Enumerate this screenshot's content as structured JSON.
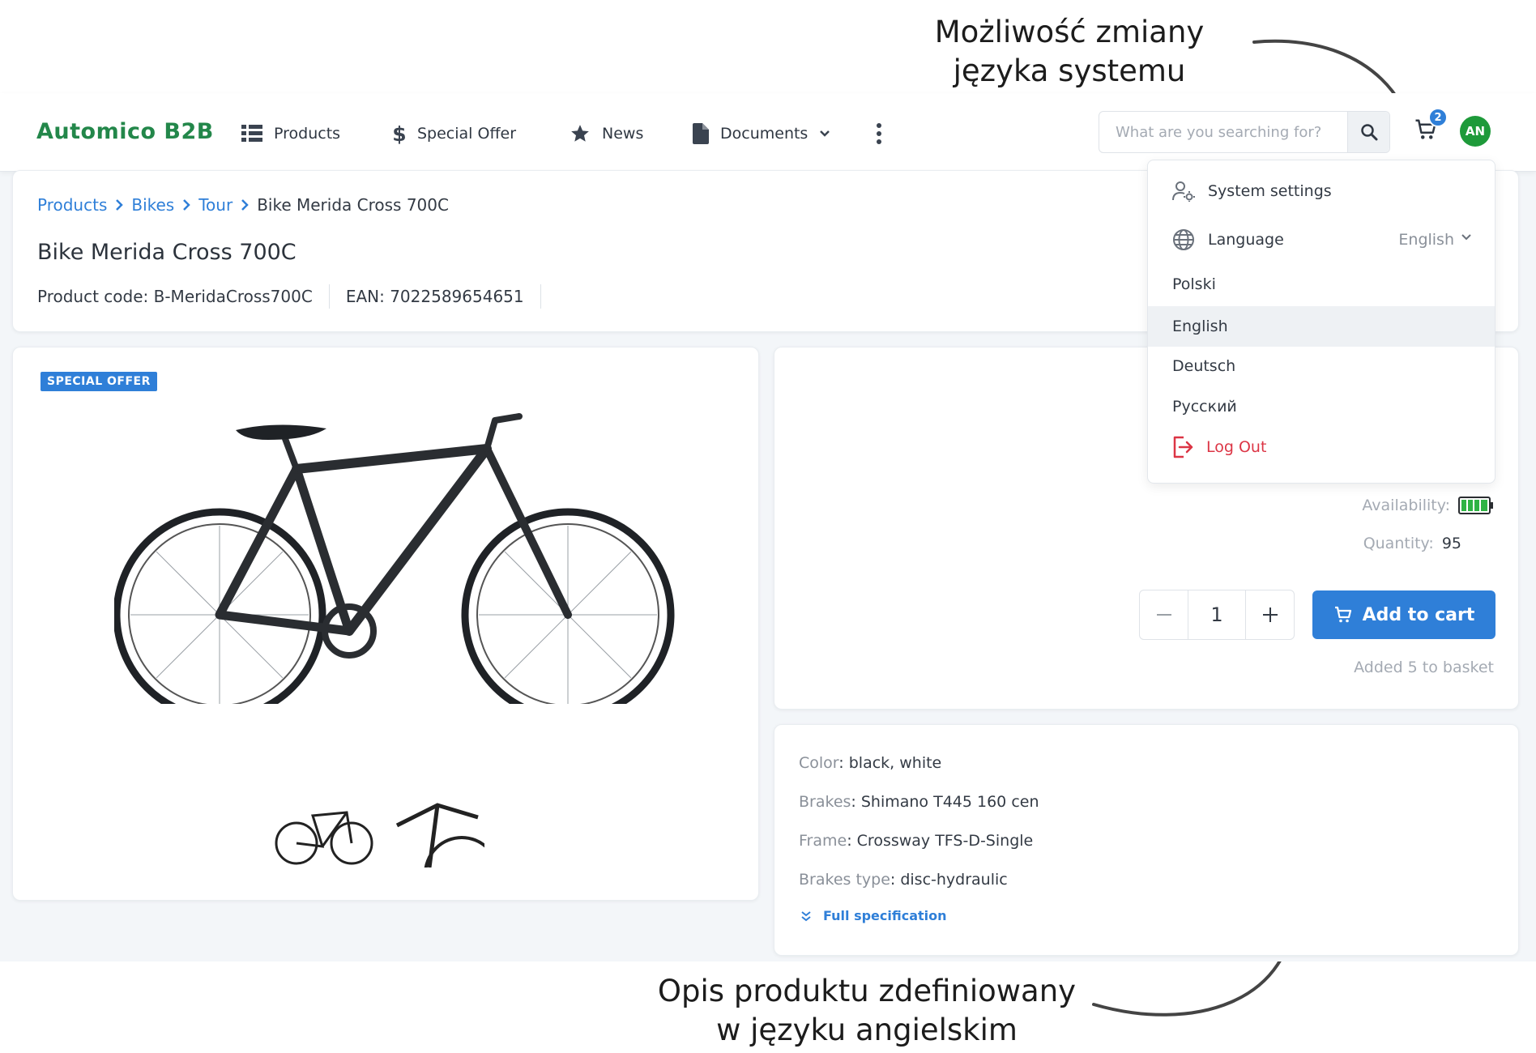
{
  "annotations": {
    "top_line1": "Możliwość zmiany",
    "top_line2": "języka systemu",
    "bottom_line1": "Opis produktu zdefiniowany",
    "bottom_line2": "w języku angielskim"
  },
  "header": {
    "logo": "Automico B2B",
    "nav": {
      "products": "Products",
      "special_offer": "Special Offer",
      "news": "News",
      "documents": "Documents"
    },
    "search_placeholder": "What are you searching for?",
    "cart_count": "2",
    "avatar_initials": "AN"
  },
  "breadcrumb": {
    "items": [
      "Products",
      "Bikes",
      "Tour"
    ],
    "current": "Bike Merida Cross 700C"
  },
  "product": {
    "title": "Bike Merida Cross 700C",
    "code": "Product code: B-MeridaCross700C",
    "ean": "EAN: 7022589654651",
    "badge": "SPECIAL OFFER",
    "availability_label": "Availability:",
    "quantity_label": "Quantity:",
    "quantity_value": "95",
    "stepper_value": "1",
    "add_to_cart": "Add to cart",
    "added_msg": "Added 5 to basket"
  },
  "specs": [
    {
      "key": "Color",
      "value": "black, white"
    },
    {
      "key": "Brakes",
      "value": "Shimano T445 160 cen"
    },
    {
      "key": "Frame",
      "value": "Crossway TFS-D-Single"
    },
    {
      "key": "Brakes type",
      "value": "disc-hydraulic"
    }
  ],
  "full_spec_link": "Full specification",
  "dropdown": {
    "system_settings": "System settings",
    "language_label": "Language",
    "language_current": "English",
    "languages": [
      "Polski",
      "English",
      "Deutsch",
      "Русский"
    ],
    "logout": "Log Out"
  },
  "colors": {
    "brand_green": "#23874a",
    "accent_blue": "#2f7fd8",
    "danger_red": "#dc3545",
    "avatar_green": "#1e9a3a",
    "battery_green": "#2fb344"
  }
}
